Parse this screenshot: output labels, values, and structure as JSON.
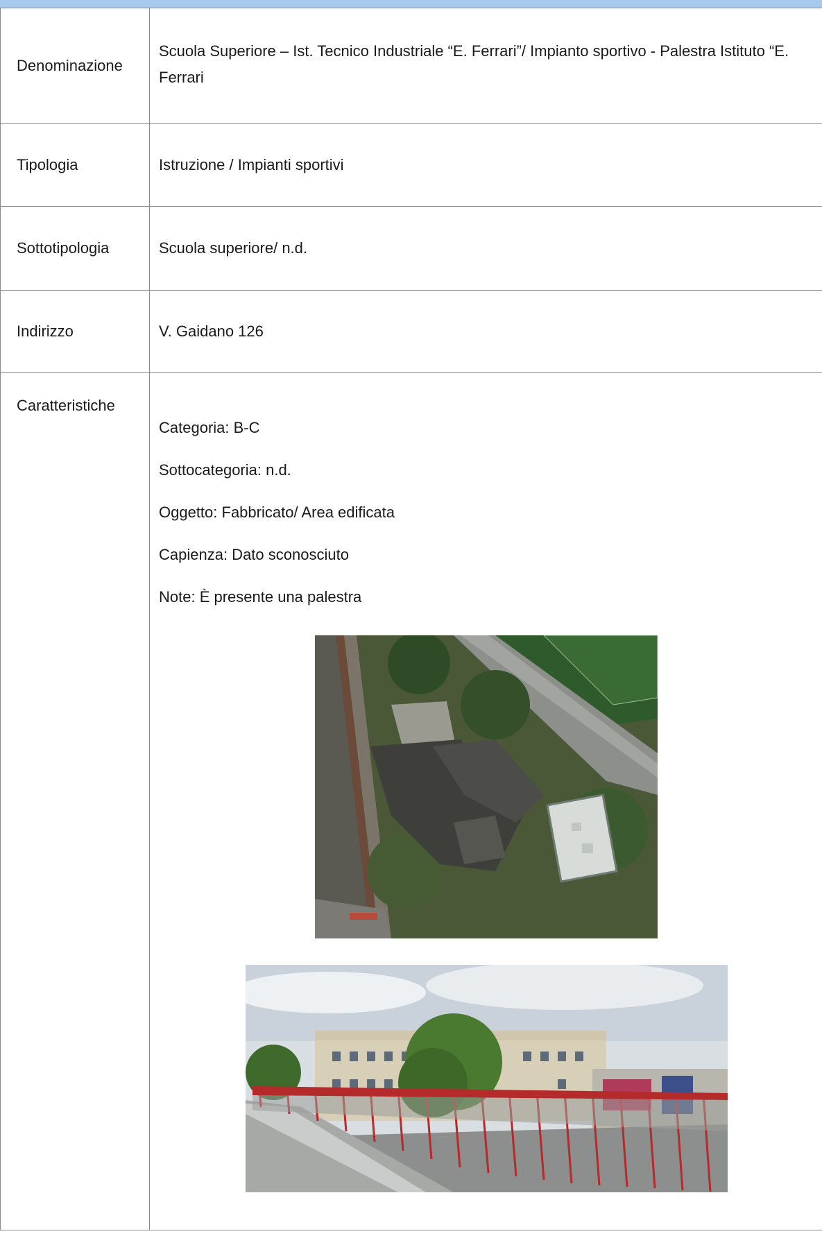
{
  "rows": [
    {
      "label": "Denominazione",
      "value": "Scuola Superiore – Ist. Tecnico Industriale “E. Ferrari”/ Impianto sportivo - Palestra Istituto “E. Ferrari"
    },
    {
      "label": "Tipologia",
      "value": "Istruzione / Impianti sportivi"
    },
    {
      "label": "Sottotipologia",
      "value": "Scuola superiore/ n.d."
    },
    {
      "label": "Indirizzo",
      "value": "V. Gaidano 126"
    }
  ],
  "caratteristiche": {
    "label": "Caratteristiche",
    "items": [
      "Categoria: B-C",
      "Sottocategoria: n.d.",
      "Oggetto: Fabbricato/ Area edificata",
      "Capienza: Dato sconosciuto",
      "Note: È presente una palestra"
    ]
  }
}
